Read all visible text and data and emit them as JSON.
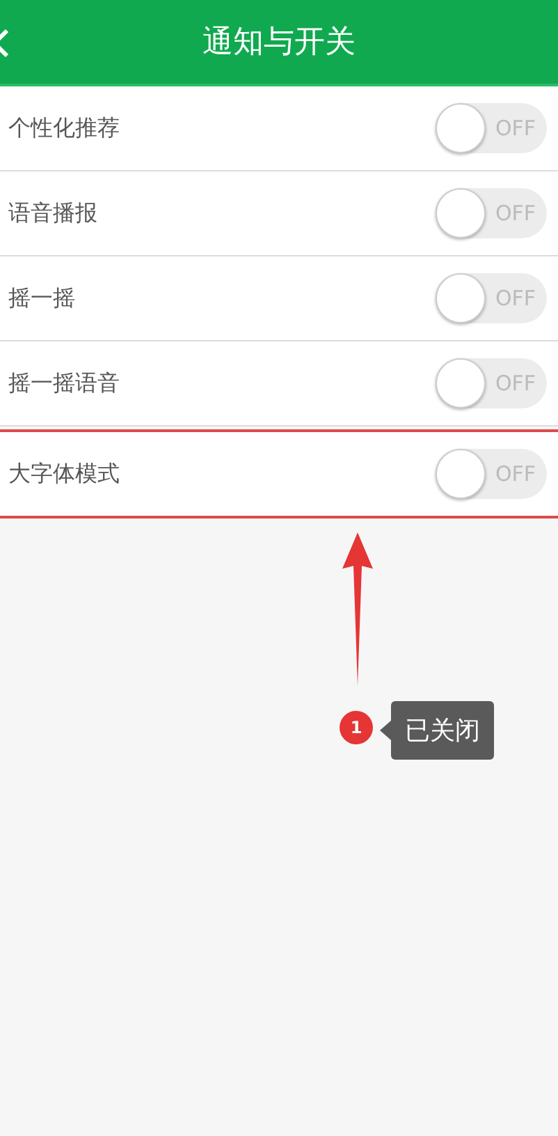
{
  "header": {
    "title": "通知与开关"
  },
  "settings": [
    {
      "label": "个性化推荐",
      "on": false,
      "switch_text": "OFF",
      "highlighted": false
    },
    {
      "label": "语音播报",
      "on": false,
      "switch_text": "OFF",
      "highlighted": false
    },
    {
      "label": "摇一摇",
      "on": false,
      "switch_text": "OFF",
      "highlighted": false
    },
    {
      "label": "摇一摇语音",
      "on": false,
      "switch_text": "OFF",
      "highlighted": false
    },
    {
      "label": "大字体模式",
      "on": false,
      "switch_text": "OFF",
      "highlighted": true
    }
  ],
  "annotation": {
    "number": "1",
    "text": "已关闭"
  }
}
